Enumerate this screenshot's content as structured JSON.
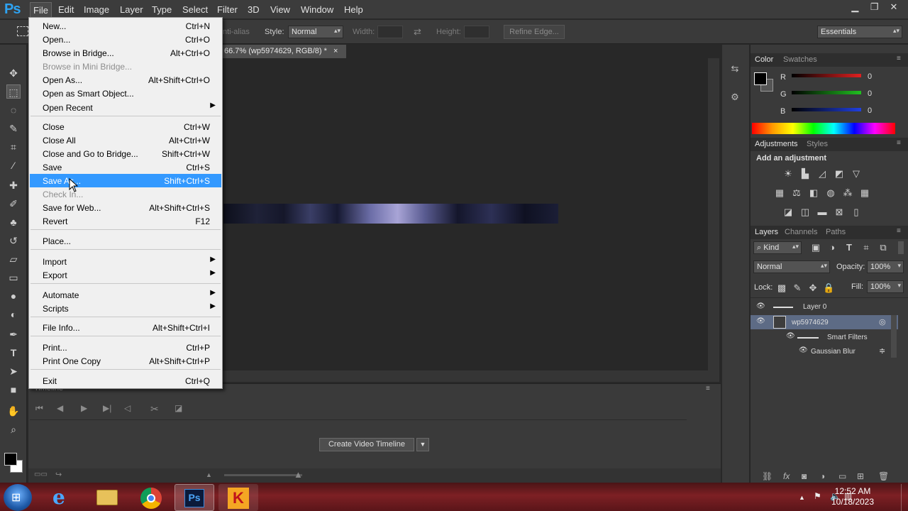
{
  "app": {
    "logo": "Ps"
  },
  "menubar": {
    "items": [
      "File",
      "Edit",
      "Image",
      "Layer",
      "Type",
      "Select",
      "Filter",
      "3D",
      "View",
      "Window",
      "Help"
    ]
  },
  "window_controls": {
    "minimize": "▁",
    "restore": "❐",
    "close": "✕"
  },
  "options": {
    "anti_alias": "nti-alias",
    "style_label": "Style:",
    "style_value": "Normal",
    "width_label": "Width:",
    "height_label": "Height:",
    "refine_edge": "Refine Edge...",
    "workspace": "Essentials"
  },
  "document": {
    "tab_title": "66.7% (wp5974629, RGB/8) *",
    "close": "×"
  },
  "file_menu": {
    "items": [
      {
        "label": "New...",
        "shortcut": "Ctrl+N"
      },
      {
        "label": "Open...",
        "shortcut": "Ctrl+O"
      },
      {
        "label": "Browse in Bridge...",
        "shortcut": "Alt+Ctrl+O"
      },
      {
        "label": "Browse in Mini Bridge...",
        "shortcut": ""
      },
      {
        "label": "Open As...",
        "shortcut": "Alt+Shift+Ctrl+O"
      },
      {
        "label": "Open as Smart Object...",
        "shortcut": ""
      },
      {
        "label": "Open Recent",
        "shortcut": ""
      },
      {
        "label": "Close",
        "shortcut": "Ctrl+W"
      },
      {
        "label": "Close All",
        "shortcut": "Alt+Ctrl+W"
      },
      {
        "label": "Close and Go to Bridge...",
        "shortcut": "Shift+Ctrl+W"
      },
      {
        "label": "Save",
        "shortcut": "Ctrl+S"
      },
      {
        "label": "Save As...",
        "shortcut": "Shift+Ctrl+S"
      },
      {
        "label": "Check In...",
        "shortcut": ""
      },
      {
        "label": "Save for Web...",
        "shortcut": "Alt+Shift+Ctrl+S"
      },
      {
        "label": "Revert",
        "shortcut": "F12"
      },
      {
        "label": "Place...",
        "shortcut": ""
      },
      {
        "label": "Import",
        "shortcut": ""
      },
      {
        "label": "Export",
        "shortcut": ""
      },
      {
        "label": "Automate",
        "shortcut": ""
      },
      {
        "label": "Scripts",
        "shortcut": ""
      },
      {
        "label": "File Info...",
        "shortcut": "Alt+Shift+Ctrl+I"
      },
      {
        "label": "Print...",
        "shortcut": "Ctrl+P"
      },
      {
        "label": "Print One Copy",
        "shortcut": "Alt+Shift+Ctrl+P"
      },
      {
        "label": "Exit",
        "shortcut": "Ctrl+Q"
      }
    ],
    "submenu_arrow": "▶"
  },
  "timeline": {
    "title": "Timeline",
    "create_button": "Create Video Timeline",
    "dropdown_arrow": "▼"
  },
  "color_panel": {
    "tabs": [
      "Color",
      "Swatches"
    ],
    "channels": [
      {
        "label": "R",
        "value": "0",
        "color": "#e02020"
      },
      {
        "label": "G",
        "value": "0",
        "color": "#20c020"
      },
      {
        "label": "B",
        "value": "0",
        "color": "#2040e0"
      }
    ]
  },
  "adjustments_panel": {
    "tabs": [
      "Adjustments",
      "Styles"
    ],
    "heading": "Add an adjustment"
  },
  "layers_panel": {
    "tabs": [
      "Layers",
      "Channels",
      "Paths"
    ],
    "kind": "Kind",
    "blend_mode": "Normal",
    "opacity_label": "Opacity:",
    "opacity_value": "100%",
    "lock_label": "Lock:",
    "fill_label": "Fill:",
    "fill_value": "100%",
    "layers": [
      {
        "name": "Layer 0"
      },
      {
        "name": "wp5974629"
      },
      {
        "name": "Smart Filters"
      },
      {
        "name": "Gaussian Blur"
      }
    ]
  },
  "taskbar": {
    "time": "12:52 AM",
    "date": "10/18/2023",
    "ps_label": "Ps"
  }
}
